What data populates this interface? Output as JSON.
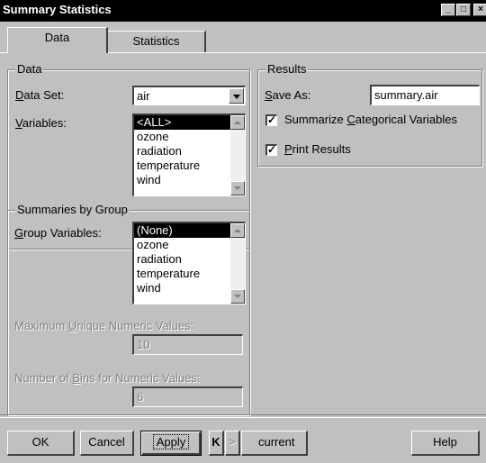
{
  "window": {
    "title": "Summary Statistics"
  },
  "tabs": [
    {
      "label": "Data"
    },
    {
      "label": "Statistics"
    }
  ],
  "data_group": {
    "title": "Data",
    "dataset_label": "Data Set:",
    "dataset_value": "air",
    "variables_label": "Variables:",
    "variables": [
      "<ALL>",
      "ozone",
      "radiation",
      "temperature",
      "wind"
    ],
    "selected_variable": "<ALL>"
  },
  "results_group": {
    "title": "Results",
    "save_as_label": "Save As:",
    "save_as_value": "summary.air",
    "summarize_categorical_label": "Summarize Categorical Variables",
    "summarize_categorical_checked": true,
    "print_results_label": "Print Results",
    "print_results_checked": true
  },
  "summaries_group": {
    "title": "Summaries by Group",
    "group_variables_label": "Group Variables:",
    "group_variables": [
      "(None)",
      "ozone",
      "radiation",
      "temperature",
      "wind"
    ],
    "selected_group": "(None)",
    "max_unique_label": "Maximum Unique Numeric Values:",
    "max_unique_value": "10",
    "num_bins_label": "Number of Bins for Numeric Values:",
    "num_bins_value": "6"
  },
  "footer": {
    "ok_label": "OK",
    "cancel_label": "Cancel",
    "apply_label": "Apply",
    "first_label": "K",
    "prev_label": ">",
    "current_label": "current",
    "help_label": "Help"
  },
  "colors": {
    "face": "#c0c0c0",
    "title_bg": "#000000",
    "highlight": "#000000",
    "disabled_text": "#808080"
  }
}
